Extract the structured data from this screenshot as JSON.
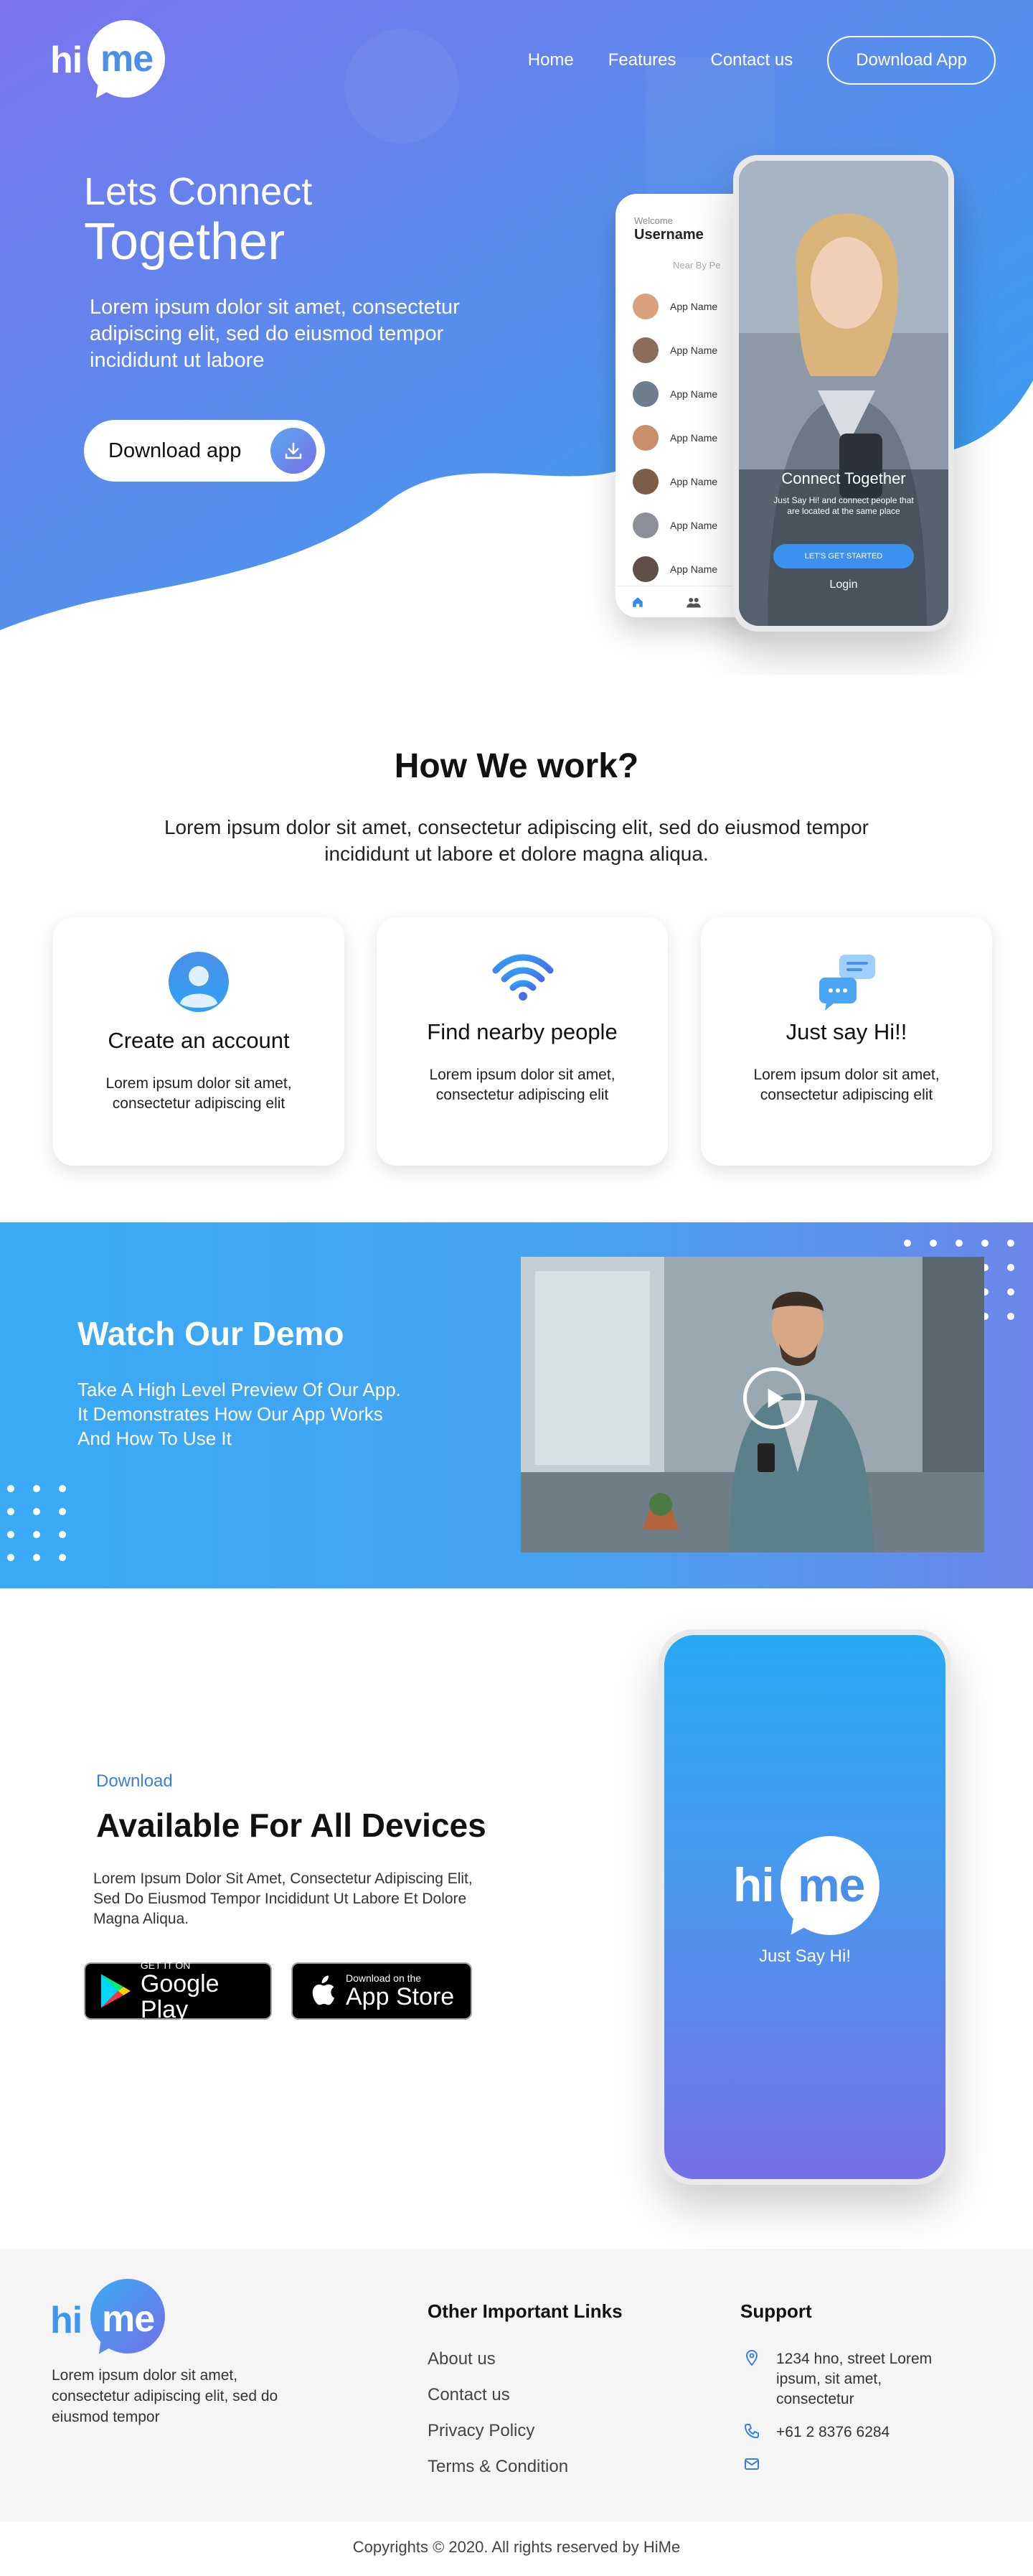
{
  "brand": {
    "logo_hi": "hi",
    "logo_me": "me",
    "accent": "#3d8ff0",
    "gradient_start": "#3aaaf4",
    "gradient_end": "#7470e6"
  },
  "nav": {
    "items": [
      {
        "label": "Home"
      },
      {
        "label": "Features"
      },
      {
        "label": "Contact us"
      }
    ],
    "cta": "Download App"
  },
  "hero": {
    "title_line1": "Lets Connect",
    "title_line2": "Together",
    "description": "Lorem ipsum dolor sit amet, consectetur adipiscing elit, sed do eiusmod tempor incididunt ut labore",
    "download_label": "Download app"
  },
  "phone_list": {
    "welcome": "Welcome",
    "username": "Username",
    "near_by": "Near By Pe",
    "items": [
      {
        "name": "App Name",
        "avatar_color": "#d9a27c"
      },
      {
        "name": "App Name",
        "avatar_color": "#8a6d5a"
      },
      {
        "name": "App Name",
        "avatar_color": "#6f7d8c"
      },
      {
        "name": "App Name",
        "avatar_color": "#c98e6a"
      },
      {
        "name": "App Name",
        "avatar_color": "#7b5d4a"
      },
      {
        "name": "App Name",
        "avatar_color": "#8b8f96"
      },
      {
        "name": "App Name",
        "avatar_color": "#5e5048"
      }
    ]
  },
  "phone_login": {
    "title": "Connect Together",
    "subtitle": "Just Say Hi! and connect people that are located at the same place",
    "start_button": "LET'S GET STARTED",
    "login": "Login"
  },
  "how": {
    "title": "How We work?",
    "description": "Lorem ipsum dolor sit amet, consectetur adipiscing elit, sed do eiusmod tempor incididunt ut labore et dolore magna aliqua.",
    "cards": [
      {
        "icon": "user-account-icon",
        "title": "Create an account",
        "text": "Lorem ipsum dolor sit amet, consectetur adipiscing elit"
      },
      {
        "icon": "wifi-signal-icon",
        "title": "Find nearby people",
        "text": "Lorem ipsum dolor sit amet, consectetur adipiscing elit"
      },
      {
        "icon": "chat-bubbles-icon",
        "title": "Just say Hi!!",
        "text": "Lorem ipsum dolor sit amet, consectetur adipiscing elit"
      }
    ]
  },
  "demo": {
    "title": "Watch Our Demo",
    "description": "Take A High Level Preview Of Our App. It Demonstrates How Our App Works And How To Use It",
    "video_icon": "play-icon"
  },
  "download": {
    "kicker": "Download",
    "title": "Available For All Devices",
    "description": "Lorem Ipsum Dolor Sit Amet, Consectetur Adipiscing Elit, Sed Do Eiusmod Tempor Incididunt Ut Labore Et Dolore Magna Aliqua.",
    "google_small": "GET IT ON",
    "google_big": "Google Play",
    "apple_small": "Download on the",
    "apple_big": "App Store",
    "phone_tagline": "Just Say Hi!"
  },
  "footer": {
    "description": "Lorem ipsum dolor sit amet, consectetur adipiscing elit, sed do eiusmod tempor",
    "links_heading": "Other Important Links",
    "links": [
      "About us",
      "Contact us",
      "Privacy Policy",
      "Terms & Condition"
    ],
    "support_heading": "Support",
    "address": "1234 hno, street Lorem ipsum, sit amet, consectetur",
    "phone": "+61 2 8376 6284",
    "email": "",
    "copyright": "Copyrights © 2020. All rights reserved by HiMe"
  }
}
